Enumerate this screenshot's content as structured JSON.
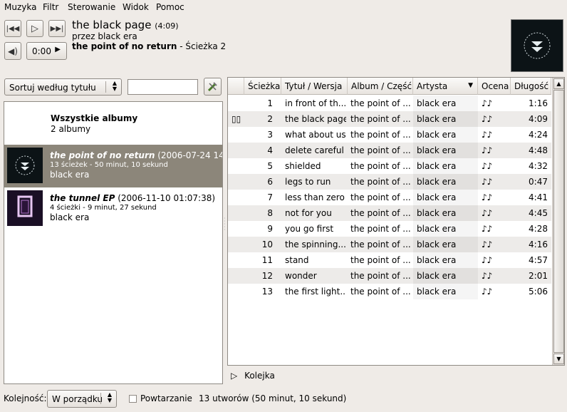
{
  "menubar": {
    "items": [
      {
        "label": "Muzyka"
      },
      {
        "label": "Filtr"
      },
      {
        "label": "Sterowanie"
      },
      {
        "label": "Widok"
      },
      {
        "label": "Pomoc"
      }
    ]
  },
  "player": {
    "prev_icon": "skip-back-icon",
    "play_icon": "play-icon",
    "next_icon": "skip-forward-icon",
    "volume_icon": "volume-icon",
    "position": "0:00",
    "title": "the black page",
    "length": "(4:09)",
    "artist_line": "przez black era",
    "album": "the point of no return",
    "track_suffix": " - Ścieżka 2"
  },
  "browser": {
    "sort_label": "Sortuj według tytułu",
    "search_value": "",
    "all_albums_title": "Wszystkie albumy",
    "all_albums_count": "2 albumy",
    "albums": [
      {
        "title": "the point of no return",
        "date": " (2006-07-24 14...",
        "info": "13 ścieżek - 50 minut, 10 sekund",
        "artist": "black era"
      },
      {
        "title": "the tunnel EP",
        "date": " (2006-11-10 01:07:38)",
        "info": "4 ścieżki - 9 minut, 27 sekund",
        "artist": "black era"
      }
    ]
  },
  "tracks": {
    "columns": [
      "Ścieżka",
      "Tytuł / Wersja",
      "Album / Część",
      "Artysta",
      "Ocena",
      "Długość"
    ],
    "rows": [
      {
        "num": "1",
        "title": "in front of th...",
        "album": "the point of ...",
        "artist": "black era",
        "rating": "♪♪",
        "length": "1:16"
      },
      {
        "num": "2",
        "title": "the black page",
        "album": "the point of ...",
        "artist": "black era",
        "rating": "♪♪",
        "length": "4:09",
        "playing": true
      },
      {
        "num": "3",
        "title": "what about us",
        "album": "the point of ...",
        "artist": "black era",
        "rating": "♪♪",
        "length": "4:24"
      },
      {
        "num": "4",
        "title": "delete careful",
        "album": "the point of ...",
        "artist": "black era",
        "rating": "♪♪",
        "length": "4:48"
      },
      {
        "num": "5",
        "title": "shielded",
        "album": "the point of ...",
        "artist": "black era",
        "rating": "♪♪",
        "length": "4:32"
      },
      {
        "num": "6",
        "title": "legs to run",
        "album": "the point of ...",
        "artist": "black era",
        "rating": "♪♪",
        "length": "0:47"
      },
      {
        "num": "7",
        "title": "less than zero",
        "album": "the point of ...",
        "artist": "black era",
        "rating": "♪♪",
        "length": "4:41"
      },
      {
        "num": "8",
        "title": "not for you",
        "album": "the point of ...",
        "artist": "black era",
        "rating": "♪♪",
        "length": "4:45"
      },
      {
        "num": "9",
        "title": "you go first",
        "album": "the point of ...",
        "artist": "black era",
        "rating": "♪♪",
        "length": "4:28"
      },
      {
        "num": "10",
        "title": "the spinning...",
        "album": "the point of ...",
        "artist": "black era",
        "rating": "♪♪",
        "length": "4:16"
      },
      {
        "num": "11",
        "title": "stand",
        "album": "the point of ...",
        "artist": "black era",
        "rating": "♪♪",
        "length": "4:57"
      },
      {
        "num": "12",
        "title": "wonder",
        "album": "the point of ...",
        "artist": "black era",
        "rating": "♪♪",
        "length": "2:01"
      },
      {
        "num": "13",
        "title": "the first light...",
        "album": "the point of ...",
        "artist": "black era",
        "rating": "♪♪",
        "length": "5:06"
      }
    ]
  },
  "queue": {
    "label": "Kolejka"
  },
  "statusbar": {
    "order_label": "Kolejność:",
    "order_value": "W porządku",
    "repeat_label": "Powtarzanie",
    "summary": "13 utworów (50 minut, 10 sekund)"
  }
}
